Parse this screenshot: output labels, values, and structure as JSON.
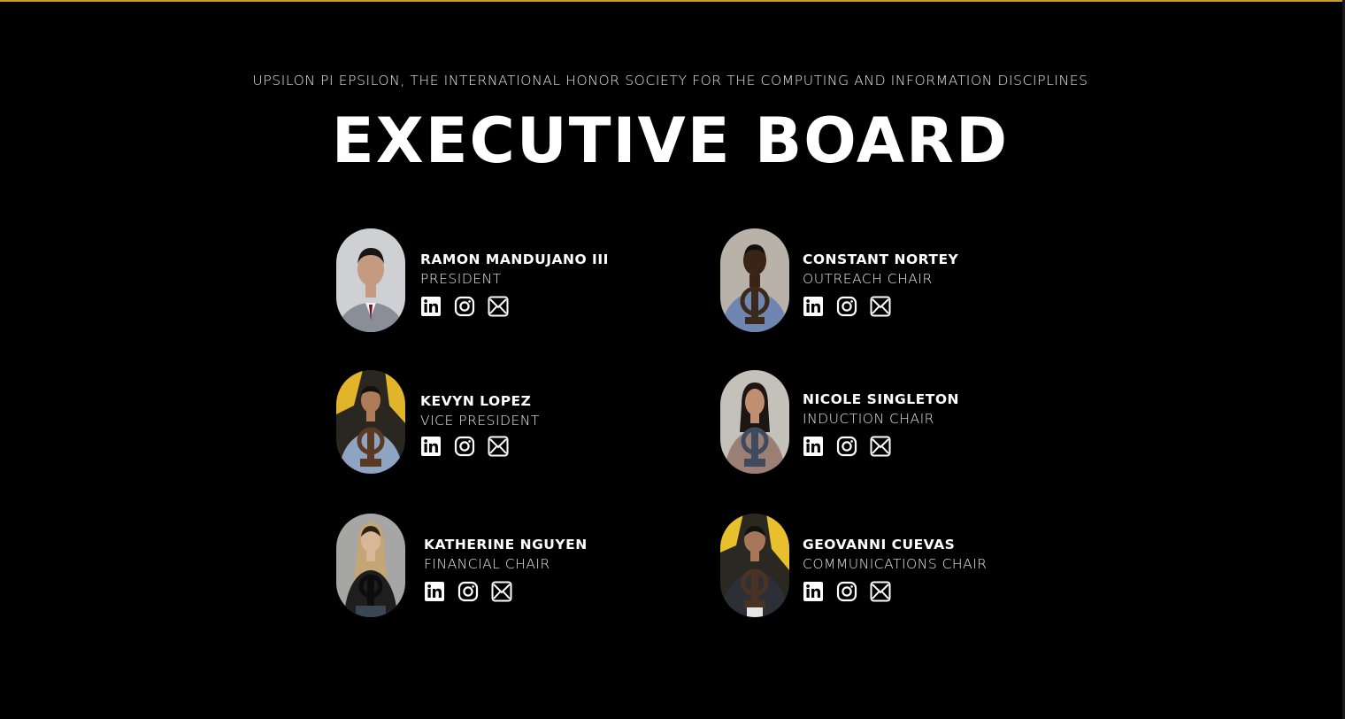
{
  "header": {
    "subtitle": "UPSILON PI EPSILON, THE INTERNATIONAL HONOR SOCIETY FOR THE COMPUTING AND INFORMATION DISCIPLINES",
    "title": "EXECUTIVE BOARD"
  },
  "social_icons": [
    "linkedin-icon",
    "instagram-icon",
    "mail-icon"
  ],
  "colors": {
    "background": "#000000",
    "accent_rule": "#c79a2b",
    "text": "#ffffff"
  },
  "members": [
    {
      "name": "RAMON MANDUJANO III",
      "role": "PRESIDENT",
      "photo_bg": "#cfd0d4",
      "shirt": "#8a8e98"
    },
    {
      "name": "CONSTANT NORTEY",
      "role": "OUTREACH CHAIR",
      "photo_bg": "#b9b2a8",
      "shirt": "#6f86b0"
    },
    {
      "name": "KEVYN LOPEZ",
      "role": "VICE PRESIDENT",
      "photo_bg": "#2a2620",
      "shirt": "#8fa3c2"
    },
    {
      "name": "NICOLE SINGLETON",
      "role": "INDUCTION CHAIR",
      "photo_bg": "#c4c0ba",
      "shirt": "#9c7f74"
    },
    {
      "name": "KATHERINE NGUYEN",
      "role": "FINANCIAL CHAIR",
      "photo_bg": "#a6a6a4",
      "shirt": "#1e1e1e"
    },
    {
      "name": "GEOVANNI CUEVAS",
      "role": "COMMUNICATIONS CHAIR",
      "photo_bg": "#2b2822",
      "shirt": "#2c2f36"
    }
  ]
}
